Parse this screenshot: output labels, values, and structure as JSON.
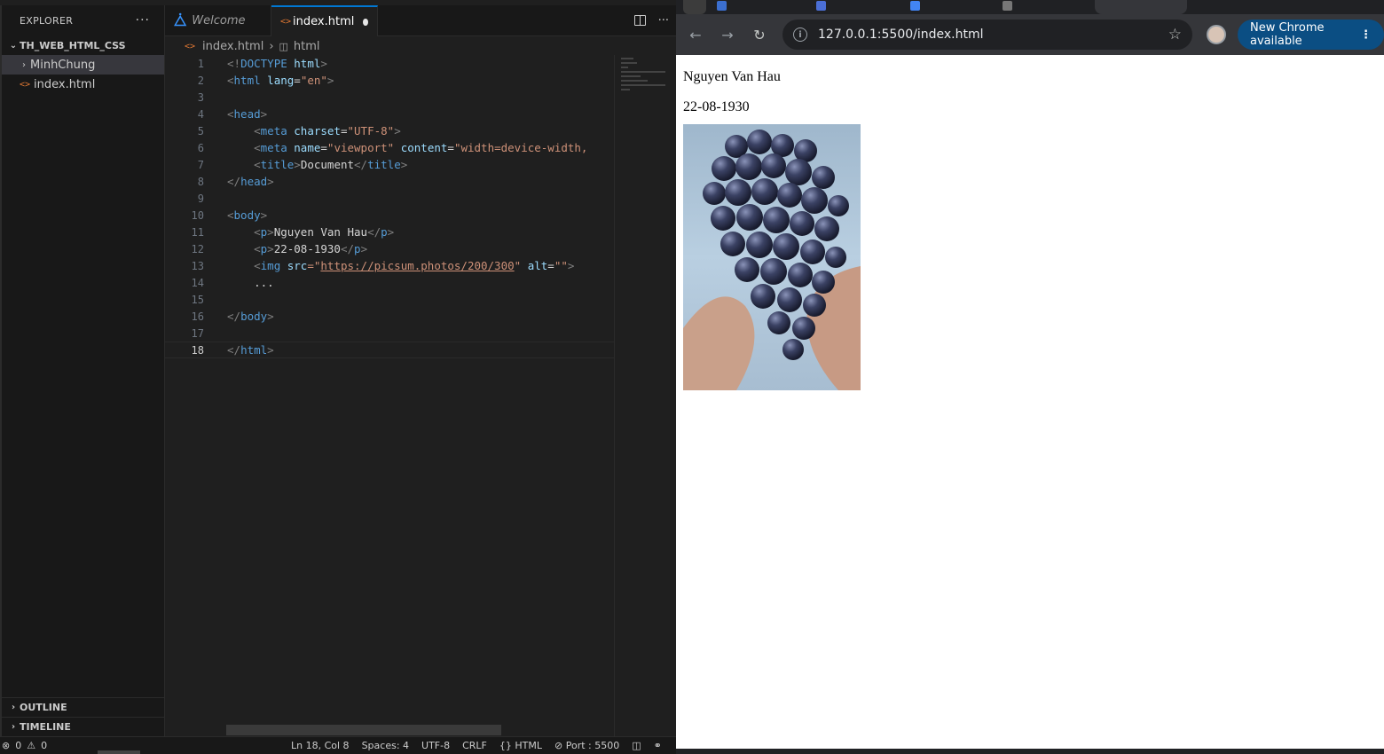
{
  "vscode": {
    "explorer": {
      "title": "EXPLORER",
      "more": "···",
      "workspace": "TH_WEB_HTML_CSS",
      "items": [
        {
          "label": "MinhChung",
          "type": "folder"
        },
        {
          "label": "index.html",
          "type": "file"
        }
      ],
      "outline": "OUTLINE",
      "timeline": "TIMELINE"
    },
    "tabs": [
      {
        "label": "Welcome"
      },
      {
        "label": "index.html"
      }
    ],
    "breadcrumb": {
      "file": "index.html",
      "symbol": "html"
    },
    "line_numbers": [
      "1",
      "2",
      "3",
      "4",
      "5",
      "6",
      "7",
      "8",
      "9",
      "10",
      "11",
      "12",
      "13",
      "14",
      "15",
      "16",
      "17",
      "18"
    ],
    "code": {
      "l1_a": "<!",
      "l1_b": "DOCTYPE",
      "l1_c": " html",
      "l1_d": ">",
      "l2_a": "<",
      "l2_b": "html",
      "l2_c": " lang",
      "l2_d": "=",
      "l2_e": "\"en\"",
      "l2_f": ">",
      "l4_a": "<",
      "l4_b": "head",
      "l4_c": ">",
      "l5_a": "<",
      "l5_b": "meta",
      "l5_c": " charset",
      "l5_d": "=",
      "l5_e": "\"UTF-8\"",
      "l5_f": ">",
      "l6_a": "<",
      "l6_b": "meta",
      "l6_c": " name",
      "l6_d": "=",
      "l6_e": "\"viewport\"",
      "l6_f": " content",
      "l6_g": "=",
      "l6_h": "\"width=device-width,",
      "l7_a": "<",
      "l7_b": "title",
      "l7_c": ">",
      "l7_d": "Document",
      "l7_e": "</",
      "l7_f": "title",
      "l7_g": ">",
      "l8_a": "</",
      "l8_b": "head",
      "l8_c": ">",
      "l10_a": "<",
      "l10_b": "body",
      "l10_c": ">",
      "l11_a": "<",
      "l11_b": "p",
      "l11_c": ">",
      "l11_d": "Nguyen Van Hau",
      "l11_e": "</",
      "l11_f": "p",
      "l11_g": ">",
      "l12_a": "<",
      "l12_b": "p",
      "l12_c": ">",
      "l12_d": "22-08-1930",
      "l12_e": "</",
      "l12_f": "p",
      "l12_g": ">",
      "l13_a": "<",
      "l13_b": "img",
      "l13_c": " src",
      "l13_d": "=\"",
      "l13_e": "https://picsum.photos/200/300",
      "l13_f": "\"",
      "l13_g": " alt",
      "l13_h": "=",
      "l13_i": "\"\"",
      "l13_j": ">",
      "l14": "...",
      "l16_a": "</",
      "l16_b": "body",
      "l16_c": ">",
      "l18_a": "</",
      "l18_b": "html",
      "l18_c": ">"
    },
    "status": {
      "errors": "0",
      "warnings": "0",
      "position": "Ln 18, Col 8",
      "spaces": "Spaces: 4",
      "encoding": "UTF-8",
      "eol": "CRLF",
      "language": "HTML",
      "port": "Port : 5500"
    }
  },
  "chrome": {
    "url": "127.0.0.1:5500/index.html",
    "update_button": "New Chrome available",
    "page": {
      "name": "Nguyen Van Hau",
      "date": "22-08-1930"
    },
    "colors": {
      "accent": "#0078d4",
      "update_bg": "#0b4e83"
    }
  }
}
